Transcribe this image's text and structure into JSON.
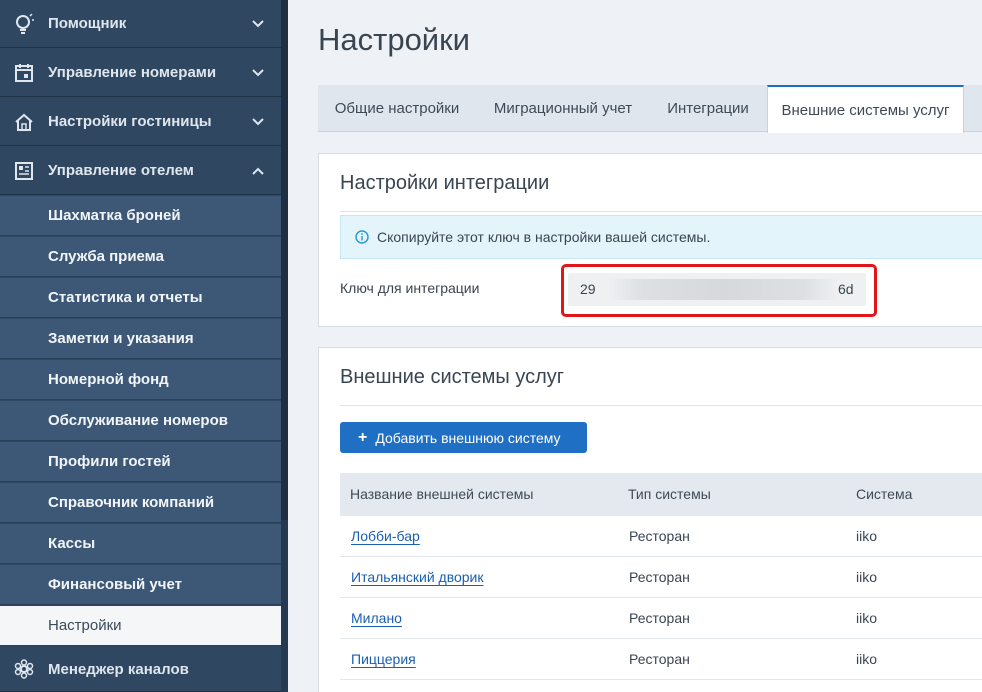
{
  "sidebar": {
    "groups": [
      {
        "label": "Помощник",
        "icon": "lightbulb-icon",
        "expanded": false
      },
      {
        "label": "Управление номерами",
        "icon": "calendar-icon",
        "expanded": false
      },
      {
        "label": "Настройки гостиницы",
        "icon": "home-icon",
        "expanded": false
      },
      {
        "label": "Управление отелем",
        "icon": "hotel-grid-icon",
        "expanded": true
      },
      {
        "label": "Менеджер каналов",
        "icon": "channels-icon",
        "expanded": false
      }
    ],
    "items": [
      {
        "label": "Шахматка броней"
      },
      {
        "label": "Служба приема"
      },
      {
        "label": "Статистика и отчеты"
      },
      {
        "label": "Заметки и указания"
      },
      {
        "label": "Номерной фонд"
      },
      {
        "label": "Обслуживание номеров"
      },
      {
        "label": "Профили гостей"
      },
      {
        "label": "Справочник компаний"
      },
      {
        "label": "Кассы"
      },
      {
        "label": "Финансовый учет"
      },
      {
        "label": "Настройки",
        "active": true
      }
    ]
  },
  "page": {
    "title": "Настройки"
  },
  "tabs": [
    {
      "label": "Общие настройки"
    },
    {
      "label": "Миграционный учет"
    },
    {
      "label": "Интеграции"
    },
    {
      "label": "Внешние системы услуг",
      "active": true
    }
  ],
  "integration": {
    "title": "Настройки интеграции",
    "alert": "Скопируйте этот ключ в настройки вашей системы.",
    "key_label": "Ключ для интеграции",
    "key_start": "29",
    "key_end": "6d"
  },
  "external": {
    "title": "Внешние системы услуг",
    "add_button": "Добавить внешнюю систему",
    "columns": [
      "Название внешней системы",
      "Тип системы",
      "Система"
    ],
    "rows": [
      {
        "name": "Лобби-бар",
        "type": "Ресторан",
        "system": "iiko"
      },
      {
        "name": "Итальянский дворик",
        "type": "Ресторан",
        "system": "iiko"
      },
      {
        "name": "Милано",
        "type": "Ресторан",
        "system": "iiko"
      },
      {
        "name": "Пиццерия",
        "type": "Ресторан",
        "system": "iiko"
      }
    ]
  },
  "colors": {
    "sidebar": "#2f4761",
    "sub": "#3d5877",
    "accent": "#1f6fc5",
    "highlight": "#e0161b"
  }
}
